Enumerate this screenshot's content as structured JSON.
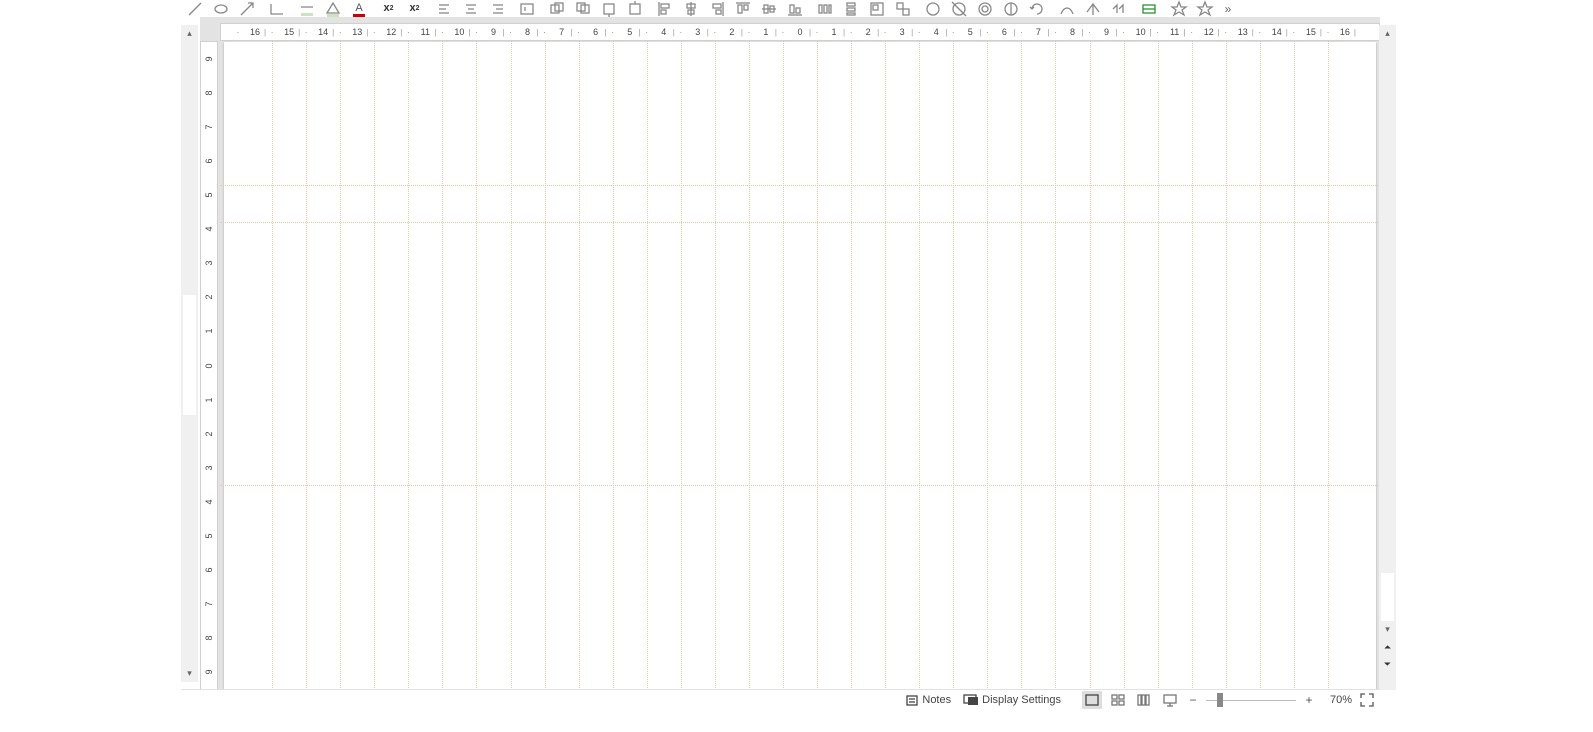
{
  "toolbar": {
    "icons": [
      "line-icon",
      "ellipse-icon",
      "arrow-icon",
      "connector-icon",
      "line-color-icon",
      "fill-color-icon",
      "font-color-icon",
      "subscript-icon",
      "superscript-icon",
      "align-left-icon",
      "align-center-icon",
      "align-right-icon",
      "insert-text-icon",
      "bring-front-icon",
      "send-back-icon",
      "bring-forward-icon",
      "send-backward-icon",
      "align-left-obj-icon",
      "align-center-obj-icon",
      "align-right-obj-icon",
      "align-top-obj-icon",
      "align-middle-obj-icon",
      "align-bottom-obj-icon",
      "distribute-horz-icon",
      "distribute-vert-icon",
      "group-icon",
      "ungroup-icon",
      "shadow-icon",
      "crop-icon",
      "filter-icon",
      "flip-icon",
      "rotate-icon",
      "fontwork-icon",
      "extrusion-icon",
      "animation-icon",
      "show-draw-icon",
      "star-5-icon",
      "star-5-outline-icon"
    ],
    "subscript_label": "x",
    "subscript_sub": "2",
    "superscript_label": "x",
    "superscript_sup": "2",
    "overflow": "»"
  },
  "rulers": {
    "horizontal": [
      16,
      15,
      14,
      13,
      12,
      11,
      10,
      9,
      8,
      7,
      6,
      5,
      4,
      3,
      2,
      1,
      0,
      1,
      2,
      3,
      4,
      5,
      6,
      7,
      8,
      9,
      10,
      11,
      12,
      13,
      14,
      15,
      16
    ],
    "vertical": [
      9,
      8,
      7,
      6,
      5,
      4,
      3,
      2,
      1,
      0,
      1,
      2,
      3,
      4,
      5,
      6,
      7,
      8,
      9
    ]
  },
  "statusbar": {
    "notes_label": "Notes",
    "display_settings_label": "Display Settings",
    "zoom_percent": "70%"
  },
  "zoom": {
    "value": 70,
    "min": 20,
    "max": 400
  },
  "canvas": {
    "horizontal_extent_cm": 17.0,
    "vertical_extent_cm": 9.5,
    "slide_half_width_cm": 16.9,
    "slide_half_height_cm": 9.5,
    "vguides_cm": [
      -15.5,
      -14.5,
      -13.5,
      -12.5,
      -11.5,
      -10.5,
      -9.5,
      -8.5,
      -7.5,
      -6.5,
      -5.5,
      -4.5,
      -3.5,
      -2.5,
      -1.5,
      -0.5,
      0.5,
      1.5,
      2.5,
      3.5,
      4.5,
      5.5,
      6.5,
      7.5,
      8.5,
      9.5,
      10.5,
      11.5,
      12.5,
      13.5,
      14.5,
      15.5
    ],
    "hguides_cm": [
      -5.3,
      -4.2,
      3.5
    ]
  }
}
